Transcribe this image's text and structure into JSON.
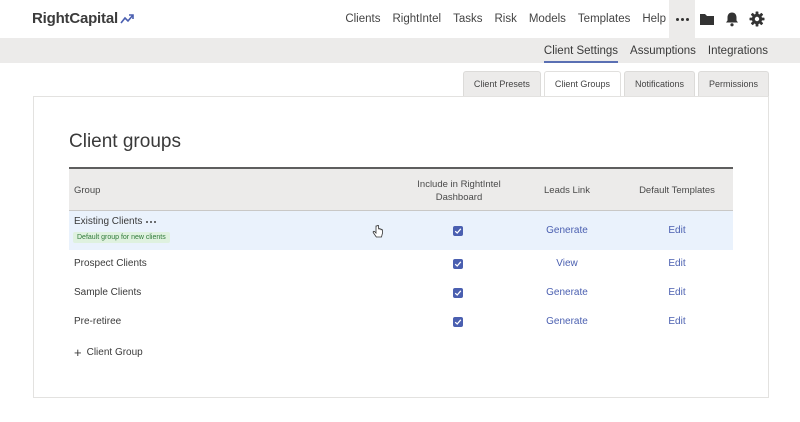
{
  "brand": {
    "name": "RightCapital",
    "accent": "#4a5fb0"
  },
  "nav": {
    "items": [
      "Clients",
      "RightIntel",
      "Tasks",
      "Risk",
      "Models",
      "Templates",
      "Help"
    ],
    "icons": [
      "more-icon",
      "folder-icon",
      "bell-icon",
      "gear-icon"
    ]
  },
  "subnav": {
    "items": [
      "Client Settings",
      "Assumptions",
      "Integrations"
    ],
    "active": "Client Settings"
  },
  "tabs": {
    "items": [
      "Client Presets",
      "Client Groups",
      "Notifications",
      "Permissions"
    ],
    "active": "Client Groups"
  },
  "page": {
    "title": "Client groups"
  },
  "table": {
    "headers": {
      "group": "Group",
      "include_line1": "Include in RightIntel",
      "include_line2": "Dashboard",
      "leads": "Leads Link",
      "templates": "Default Templates"
    },
    "rows": [
      {
        "name": "Existing Clients",
        "badge": "Default group for new clients",
        "included": true,
        "leads": "Generate",
        "templates": "Edit"
      },
      {
        "name": "Prospect Clients",
        "included": true,
        "leads": "View",
        "templates": "Edit"
      },
      {
        "name": "Sample Clients",
        "included": true,
        "leads": "Generate",
        "templates": "Edit"
      },
      {
        "name": "Pre-retiree",
        "included": true,
        "leads": "Generate",
        "templates": "Edit"
      }
    ],
    "add_label": "Client Group"
  }
}
